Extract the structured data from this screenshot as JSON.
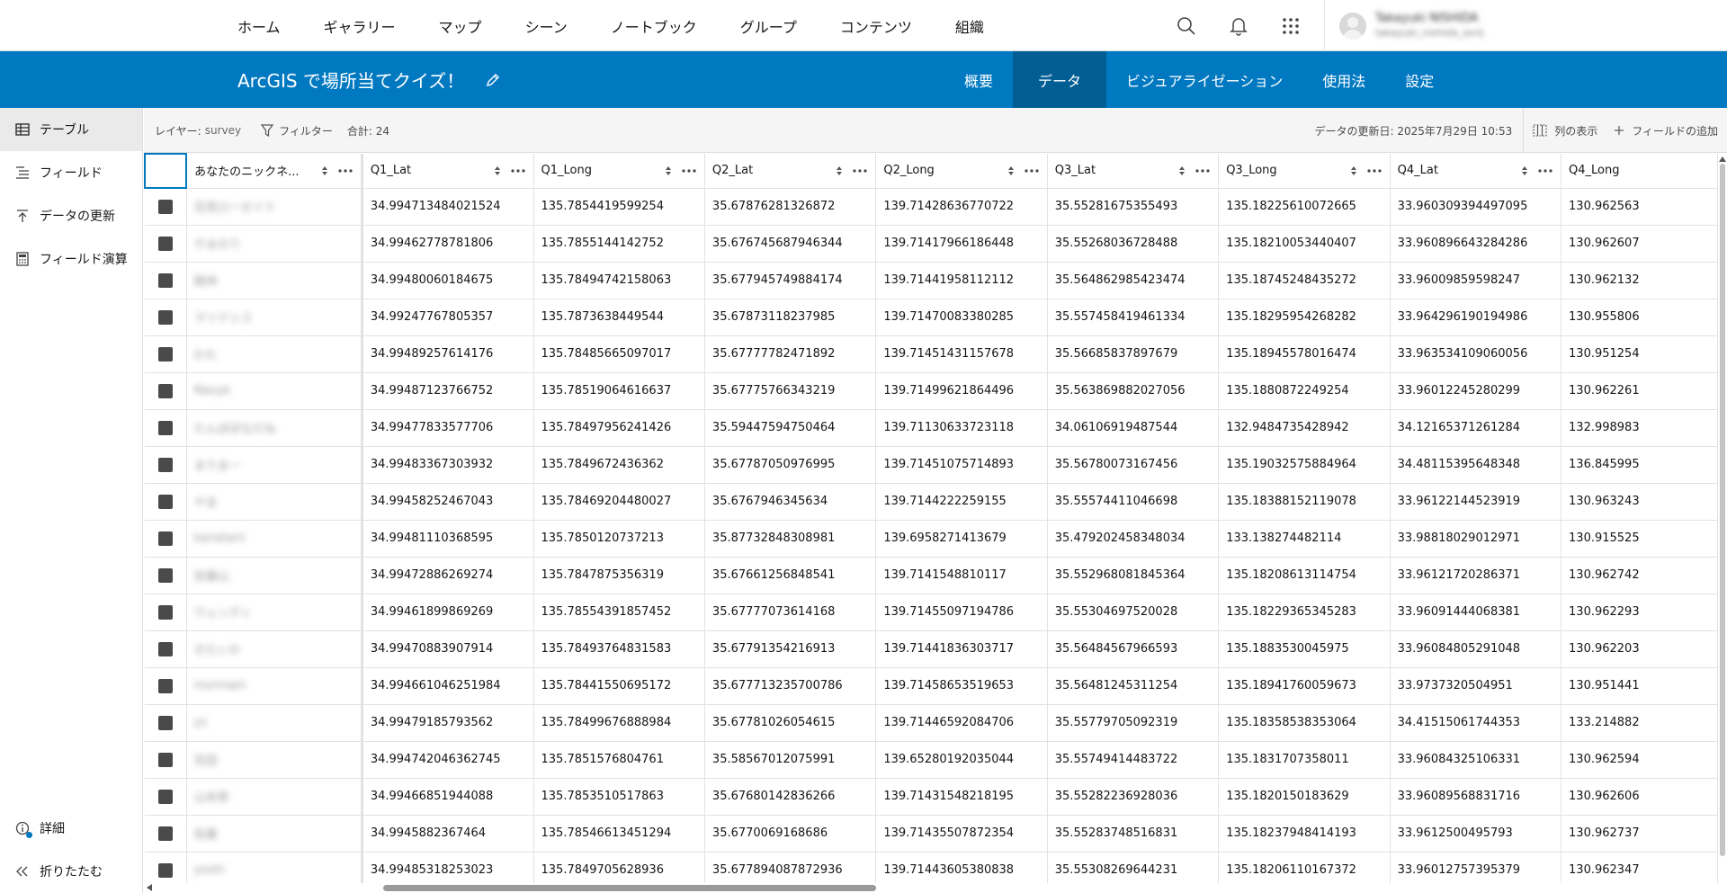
{
  "topnav": {
    "links": [
      "ホーム",
      "ギャラリー",
      "マップ",
      "シーン",
      "ノートブック",
      "グループ",
      "コンテンツ",
      "組織"
    ],
    "user": {
      "name": "Takayuki NISHIDA",
      "handle": "takayuki_nishida_esrij"
    },
    "icons": [
      "search-icon",
      "bell-icon",
      "app-launcher-icon",
      "avatar"
    ]
  },
  "header": {
    "title": "ArcGIS で場所当てクイズ！",
    "tabs": [
      "概要",
      "データ",
      "ビジュアライゼーション",
      "使用法",
      "設定"
    ],
    "active_tab": "データ",
    "accent": "#0079c1",
    "active_tab_bg": "#005e95"
  },
  "sidebar": {
    "items": [
      {
        "label": "テーブル",
        "icon": "table-icon",
        "active": true
      },
      {
        "label": "フィールド",
        "icon": "fields-icon",
        "active": false
      },
      {
        "label": "データの更新",
        "icon": "upload-icon",
        "active": false
      },
      {
        "label": "フィールド演算",
        "icon": "calculator-icon",
        "active": false
      }
    ],
    "bottom": [
      {
        "label": "詳細",
        "icon": "info-icon"
      },
      {
        "label": "折りたたむ",
        "icon": "collapse-icon"
      }
    ]
  },
  "toolbar": {
    "layer_label": "レイヤー:",
    "layer_value": "survey",
    "filter_label": "フィルター",
    "total_label": "合計: 24",
    "updated_label": "データの更新日: 2025年7月29日 10:53",
    "show_columns_label": "列の表示",
    "add_field_label": "フィールドの追加"
  },
  "table": {
    "columns": [
      "あなたのニックネ...",
      "Q1_Lat",
      "Q1_Long",
      "Q2_Lat",
      "Q2_Long",
      "Q3_Lat",
      "Q3_Long",
      "Q4_Lat",
      "Q4_Long"
    ],
    "rows": [
      [
        "花見ローゼイド",
        "34.994713484021524",
        "135.7854419599254",
        "35.67876281326872",
        "139.71428636770722",
        "35.55281675355493",
        "135.18225610072665",
        "33.960309394497095",
        "130.962563"
      ],
      [
        "やまのり",
        "34.99462778781806",
        "135.7855144142752",
        "35.676745687946344",
        "139.71417966186448",
        "35.55268036728488",
        "135.18210053440407",
        "33.960896643284286",
        "130.962607"
      ],
      [
        "館林",
        "34.99480060184675",
        "135.78494742158063",
        "35.677945749884174",
        "139.71441958112112",
        "35.564862985423474",
        "135.18745248435272",
        "33.96009859598247",
        "130.962132"
      ],
      [
        "マリナシス",
        "34.99247767805357",
        "135.7873638449544",
        "35.67873118237985",
        "139.71470083380285",
        "35.557458419461334",
        "135.18295954268282",
        "33.964296190194986",
        "130.955806"
      ],
      [
        "わた",
        "34.99489257614176",
        "135.78485665097017",
        "35.67777782471892",
        "139.71451431157678",
        "35.56685837897679",
        "135.18945578016474",
        "33.963534109060056",
        "130.951254"
      ],
      [
        "Naoyk",
        "34.99487123766752",
        "135.78519064616637",
        "35.67775766343219",
        "139.71499621864496",
        "35.563869882027056",
        "135.1880872249254",
        "33.96012245280299",
        "130.962261"
      ],
      [
        "たんぽぽなだね",
        "34.99477833577706",
        "135.78497956241426",
        "35.59447594750464",
        "139.71130633723118",
        "34.06106919487544",
        "132.9484735428942",
        "34.12165371261284",
        "132.998983"
      ],
      [
        "まりまー",
        "34.99483367303932",
        "135.7849672436362",
        "35.67787050976995",
        "139.71451075714893",
        "35.56780073167456",
        "135.19032575884964",
        "34.48115395648348",
        "136.845995"
      ],
      [
        "やま",
        "34.99458252467043",
        "135.78469204480027",
        "35.6767946345634",
        "139.7144222259155",
        "35.55574411046698",
        "135.18388152119078",
        "33.96122144523919",
        "130.963243"
      ],
      [
        "kanatani",
        "34.99481110368595",
        "135.7850120737213",
        "35.87732848308981",
        "139.6958271413679",
        "35.479202458348034",
        "133.138274482114",
        "33.98818029012971",
        "130.915525"
      ],
      [
        "佐藤山",
        "34.99472886269274",
        "135.7847875356319",
        "35.67661256848541",
        "139.7141548810117",
        "35.552968081845364",
        "135.18208613114754",
        "33.96121720286371",
        "130.962742"
      ],
      [
        "ウェンディ",
        "34.99461899869269",
        "135.78554391857452",
        "35.67777073614168",
        "139.71455097194786",
        "35.55304697520028",
        "135.18229365345283",
        "33.96091444068381",
        "130.962293"
      ],
      [
        "せたいか",
        "34.99470883907914",
        "135.78493764831583",
        "35.67791354216913",
        "139.71441836303717",
        "35.56484567966593",
        "135.1883530045975",
        "33.96084805291048",
        "130.962203"
      ],
      [
        "mormain",
        "34.994661046251984",
        "135.78441550695172",
        "35.677713235700786",
        "139.71458653519653",
        "35.56481245311254",
        "135.18941760059673",
        "33.9737320504951",
        "130.951441"
      ],
      [
        "ys",
        "34.99479185793562",
        "135.78499676888984",
        "35.67781026054615",
        "139.71446592084706",
        "35.55779705092319",
        "135.18358538353064",
        "34.41515061744353",
        "133.214882"
      ],
      [
        "花田",
        "34.994742046362745",
        "135.7851576804761",
        "35.58567012075991",
        "139.65280192035044",
        "35.55749414483722",
        "135.1831707358011",
        "33.96084325106331",
        "130.962594"
      ],
      [
        "山本家",
        "34.99466851944088",
        "135.7853510517863",
        "35.67680142836266",
        "139.71431548218195",
        "35.55282236928036",
        "135.1820150183629",
        "33.96089568831716",
        "130.962606"
      ],
      [
        "佐藤",
        "34.9945882367464",
        "135.78546613451294",
        "35.6770069168686",
        "139.71435507872354",
        "35.55283748516831",
        "135.18237948414193",
        "33.9612500495793",
        "130.962737"
      ],
      [
        "yoshi",
        "34.99485318253023",
        "135.7849705628936",
        "35.677894087872936",
        "139.71443605380838",
        "35.55308269644231",
        "135.18206110167372",
        "33.96012757395379",
        "130.962347"
      ]
    ]
  }
}
